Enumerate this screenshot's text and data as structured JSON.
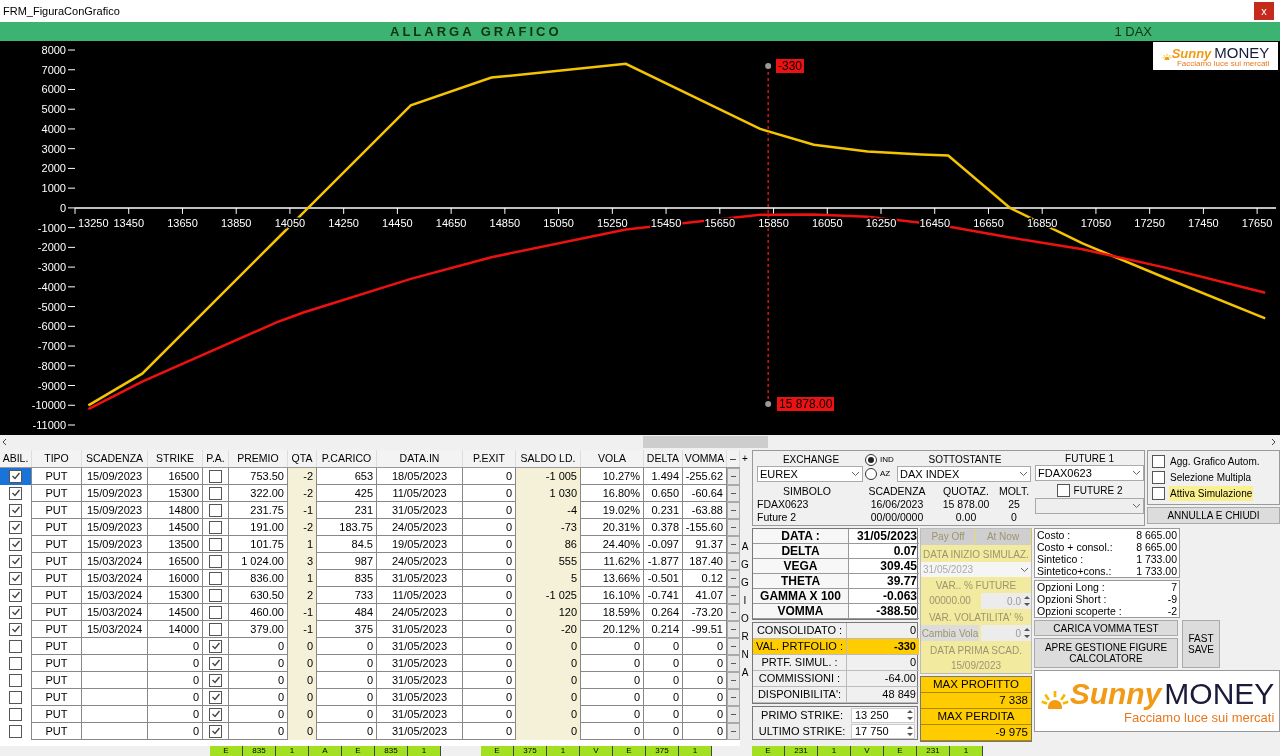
{
  "window": {
    "title": "FRM_FiguraConGrafico",
    "close": "x"
  },
  "header_bar": {
    "title": "ALLARGA GRAFICO",
    "underlying": "1 DAX"
  },
  "chart": {
    "logo": {
      "script": "Sunny",
      "word": "MONEY",
      "tagline": "Facciamo luce sui mercati"
    },
    "cursor": {
      "value_label": "-330",
      "price_label": "15 878.00"
    },
    "chart_data": {
      "type": "line",
      "x": [
        13300,
        13500,
        14000,
        14100,
        14500,
        14800,
        15300,
        15800,
        16000,
        16200,
        16400,
        16500,
        16730,
        17000,
        17300,
        17680
      ],
      "series": [
        {
          "color": "#f5c400",
          "values": [
            -10000,
            -8400,
            -1600,
            -240,
            5200,
            6600,
            7300,
            4000,
            3200,
            2850,
            2700,
            2650,
            0,
            -1800,
            -3500,
            -5600
          ]
        },
        {
          "color": "#ee1111",
          "values": [
            -10200,
            -8800,
            -5800,
            -5300,
            -3600,
            -2500,
            -1100,
            -350,
            -330,
            -450,
            -750,
            -950,
            -1500,
            -2100,
            -3000,
            -4300
          ]
        }
      ],
      "ref_lines": [
        {
          "axis": "x",
          "value": 15830
        }
      ],
      "xlim": [
        13250,
        17750
      ],
      "ylim": [
        -11000,
        8000
      ],
      "xticks": [
        13250,
        13450,
        13650,
        13850,
        14050,
        14250,
        14450,
        14650,
        14850,
        15050,
        15250,
        15450,
        15650,
        15850,
        16050,
        16250,
        16450,
        16650,
        16850,
        17050,
        17250,
        17450,
        17650
      ],
      "yticks": [
        8000,
        7000,
        6000,
        5000,
        4000,
        3000,
        2000,
        1000,
        0,
        -1000,
        -2000,
        -3000,
        -4000,
        -5000,
        -6000,
        -7000,
        -8000,
        -9000,
        -10000,
        -11000
      ]
    }
  },
  "table": {
    "columns": [
      "ABIL.",
      "TIPO",
      "SCADENZA",
      "STRIKE",
      "P.A.",
      "PREMIO",
      "QTA",
      "P.CARICO",
      "DATA.IN",
      "P.EXIT",
      "SALDO LD.",
      "VOLA",
      "DELTA",
      "VOMMA",
      "–"
    ],
    "add_button": "+",
    "rows": [
      {
        "selected": true,
        "abil": true,
        "tipo": "PUT",
        "scadenza": "15/09/2023",
        "strike": "16500",
        "pa": false,
        "premio": "753.50",
        "qta": "-2",
        "pcarico": "653",
        "data_in": "18/05/2023",
        "pexit": "0",
        "saldo": "-1 005",
        "vola": "10.27%",
        "delta": "1.494",
        "vomma": "-255.62",
        "action": "–"
      },
      {
        "selected": false,
        "abil": true,
        "tipo": "PUT",
        "scadenza": "15/09/2023",
        "strike": "15300",
        "pa": false,
        "premio": "322.00",
        "qta": "-2",
        "pcarico": "425",
        "data_in": "11/05/2023",
        "pexit": "0",
        "saldo": "1 030",
        "vola": "16.80%",
        "delta": "0.650",
        "vomma": "-60.64",
        "action": "–"
      },
      {
        "selected": false,
        "abil": true,
        "tipo": "PUT",
        "scadenza": "15/09/2023",
        "strike": "14800",
        "pa": false,
        "premio": "231.75",
        "qta": "-1",
        "pcarico": "231",
        "data_in": "31/05/2023",
        "pexit": "0",
        "saldo": "-4",
        "vola": "19.02%",
        "delta": "0.231",
        "vomma": "-63.88",
        "action": "–"
      },
      {
        "selected": false,
        "abil": true,
        "tipo": "PUT",
        "scadenza": "15/09/2023",
        "strike": "14500",
        "pa": false,
        "premio": "191.00",
        "qta": "-2",
        "pcarico": "183.75",
        "data_in": "24/05/2023",
        "pexit": "0",
        "saldo": "-73",
        "vola": "20.31%",
        "delta": "0.378",
        "vomma": "-155.60",
        "action": "–"
      },
      {
        "selected": false,
        "abil": true,
        "tipo": "PUT",
        "scadenza": "15/09/2023",
        "strike": "13500",
        "pa": false,
        "premio": "101.75",
        "qta": "1",
        "pcarico": "84.5",
        "data_in": "19/05/2023",
        "pexit": "0",
        "saldo": "86",
        "vola": "24.40%",
        "delta": "-0.097",
        "vomma": "91.37",
        "action": "–"
      },
      {
        "selected": false,
        "abil": true,
        "tipo": "PUT",
        "scadenza": "15/03/2024",
        "strike": "16500",
        "pa": false,
        "premio": "1 024.00",
        "qta": "3",
        "pcarico": "987",
        "data_in": "24/05/2023",
        "pexit": "0",
        "saldo": "555",
        "vola": "11.62%",
        "delta": "-1.877",
        "vomma": "187.40",
        "action": "–"
      },
      {
        "selected": false,
        "abil": true,
        "tipo": "PUT",
        "scadenza": "15/03/2024",
        "strike": "16000",
        "pa": false,
        "premio": "836.00",
        "qta": "1",
        "pcarico": "835",
        "data_in": "31/05/2023",
        "pexit": "0",
        "saldo": "5",
        "vola": "13.66%",
        "delta": "-0.501",
        "vomma": "0.12",
        "action": "–"
      },
      {
        "selected": false,
        "abil": true,
        "tipo": "PUT",
        "scadenza": "15/03/2024",
        "strike": "15300",
        "pa": false,
        "premio": "630.50",
        "qta": "2",
        "pcarico": "733",
        "data_in": "11/05/2023",
        "pexit": "0",
        "saldo": "-1 025",
        "vola": "16.10%",
        "delta": "-0.741",
        "vomma": "41.07",
        "action": "–"
      },
      {
        "selected": false,
        "abil": true,
        "tipo": "PUT",
        "scadenza": "15/03/2024",
        "strike": "14500",
        "pa": false,
        "premio": "460.00",
        "qta": "-1",
        "pcarico": "484",
        "data_in": "24/05/2023",
        "pexit": "0",
        "saldo": "120",
        "vola": "18.59%",
        "delta": "0.264",
        "vomma": "-73.20",
        "action": "–"
      },
      {
        "selected": false,
        "abil": true,
        "tipo": "PUT",
        "scadenza": "15/03/2024",
        "strike": "14000",
        "pa": false,
        "premio": "379.00",
        "qta": "-1",
        "pcarico": "375",
        "data_in": "31/05/2023",
        "pexit": "0",
        "saldo": "-20",
        "vola": "20.12%",
        "delta": "0.214",
        "vomma": "-99.51",
        "action": "–"
      },
      {
        "selected": false,
        "abil": false,
        "tipo": "PUT",
        "strike": "0",
        "pa": true,
        "premio": "0",
        "qta": "0",
        "pcarico": "0",
        "data_in": "31/05/2023",
        "pexit": "0",
        "saldo": "0",
        "vola": "0",
        "delta": "0",
        "vomma": "0",
        "action": "–"
      },
      {
        "selected": false,
        "abil": false,
        "tipo": "PUT",
        "strike": "0",
        "pa": true,
        "premio": "0",
        "qta": "0",
        "pcarico": "0",
        "data_in": "31/05/2023",
        "pexit": "0",
        "saldo": "0",
        "vola": "0",
        "delta": "0",
        "vomma": "0",
        "action": "–"
      },
      {
        "selected": false,
        "abil": false,
        "tipo": "PUT",
        "strike": "0",
        "pa": true,
        "premio": "0",
        "qta": "0",
        "pcarico": "0",
        "data_in": "31/05/2023",
        "pexit": "0",
        "saldo": "0",
        "vola": "0",
        "delta": "0",
        "vomma": "0",
        "action": "–"
      },
      {
        "selected": false,
        "abil": false,
        "tipo": "PUT",
        "strike": "0",
        "pa": true,
        "premio": "0",
        "qta": "0",
        "pcarico": "0",
        "data_in": "31/05/2023",
        "pexit": "0",
        "saldo": "0",
        "vola": "0",
        "delta": "0",
        "vomma": "0",
        "action": "–"
      },
      {
        "selected": false,
        "abil": false,
        "tipo": "PUT",
        "strike": "0",
        "pa": true,
        "premio": "0",
        "qta": "0",
        "pcarico": "0",
        "data_in": "31/05/2023",
        "pexit": "0",
        "saldo": "0",
        "vola": "0",
        "delta": "0",
        "vomma": "0",
        "action": "–"
      },
      {
        "selected": false,
        "abil": false,
        "tipo": "PUT",
        "strike": "0",
        "pa": true,
        "premio": "0",
        "qta": "0",
        "pcarico": "0",
        "data_in": "31/05/2023",
        "pexit": "0",
        "saldo": "0",
        "vola": "0",
        "delta": "0",
        "vomma": "0",
        "action": "–"
      }
    ]
  },
  "refresh_label": "AGGIORNA",
  "market": {
    "exchange": {
      "label": "EXCHANGE",
      "value": "EUREX"
    },
    "radios": [
      {
        "label": "IND",
        "selected": true
      },
      {
        "label": "AZ",
        "selected": false
      }
    ],
    "underlying": {
      "label": "SOTTOSTANTE",
      "value": "DAX INDEX"
    },
    "future1": {
      "label": "FUTURE 1",
      "value": "FDAX0623"
    },
    "future2": {
      "label": "FUTURE 2",
      "checked": false
    },
    "instrument_columns": [
      "SIMBOLO",
      "SCADENZA",
      "QUOTAZ.",
      "MOLT."
    ],
    "instruments": [
      [
        "FDAX0623",
        "16/06/2023",
        "15 878.00",
        "25"
      ],
      [
        "Future 2",
        "00/00/0000",
        "0.00",
        "0"
      ]
    ]
  },
  "options": [
    {
      "label": "Agg. Grafico Autom.",
      "checked": false,
      "highlighted": false
    },
    {
      "label": "Selezione Multipla",
      "checked": false,
      "highlighted": false
    },
    {
      "label": "Attiva Simulazione",
      "checked": false,
      "highlighted": true
    }
  ],
  "close_button": "ANNULLA E CHIUDI",
  "greeks": [
    {
      "label": "DATA :",
      "value": "31/05/2023"
    },
    {
      "label": "DELTA",
      "value": "0.07"
    },
    {
      "label": "VEGA",
      "value": "309.45"
    },
    {
      "label": "THETA",
      "value": "39.77"
    },
    {
      "label": "GAMMA X 100",
      "value": "-0.063"
    },
    {
      "label": "VOMMA",
      "value": "-388.50"
    }
  ],
  "portfolio": [
    {
      "label": "CONSOLIDATO :",
      "value": "0",
      "highlighted": false
    },
    {
      "label": "VAL. PRTFOLIO :",
      "value": "-330",
      "highlighted": true
    },
    {
      "label": "PRTF. SIMUL. :",
      "value": "0",
      "highlighted": false
    },
    {
      "label": "COMMISSIONI :",
      "value": "-64.00",
      "highlighted": false
    },
    {
      "label": "DISPONIBILITA':",
      "value": "48 849",
      "highlighted": false
    }
  ],
  "strikes": [
    {
      "label": "PRIMO STRIKE:",
      "value": "13 250"
    },
    {
      "label": "ULTIMO STRIKE:",
      "value": "17 750"
    }
  ],
  "simulation": {
    "disabled": true,
    "tabs": [
      {
        "label": "Pay Off",
        "selected": false
      },
      {
        "label": "At Now",
        "selected": false
      }
    ],
    "start_label": "DATA INIZIO SIMULAZ.",
    "start_date": "31/05/2023",
    "future_label": "VAR.. % FUTURE",
    "future_value": "00000.00",
    "future_pct": "0.0",
    "vola_label": "VAR. VOLATILITA' %",
    "vola_button": "Cambia Vola",
    "vola_value": "0",
    "first_expiry_label": "DATA PRIMA SCAD.",
    "first_expiry": "15/09/2023"
  },
  "extremes": [
    {
      "label": "MAX PROFITTO",
      "value": "7 338"
    },
    {
      "label": "MAX PERDITA",
      "value": "-9 975"
    }
  ],
  "costs": [
    {
      "label": "Costo :",
      "value": "8 665.00"
    },
    {
      "label": "Costo + consol.:",
      "value": "8 665.00"
    },
    {
      "label": "Sintetico :",
      "value": "1 733.00"
    },
    {
      "label": "Sintetico+cons.:",
      "value": "1 733.00"
    }
  ],
  "option_counts": [
    {
      "label": "Opzioni Long :",
      "value": "7"
    },
    {
      "label": "Opzioni Short :",
      "value": "-9"
    },
    {
      "label": "Opzioni scoperte :",
      "value": "-2"
    }
  ],
  "buttons": {
    "vomma_test": "CARICA VOMMA TEST",
    "open_manager": "APRE GESTIONE FIGURE CALCOLATORE",
    "fast_save": "FAST SAVE"
  },
  "logo": {
    "script": "Sunny",
    "word": "MONEY",
    "tagline": "Facciamo luce sui mercati"
  },
  "bottom_strip": [
    [
      "E",
      "835",
      "1",
      "A",
      "E",
      "835",
      "1"
    ],
    [
      "E",
      "375",
      "1",
      "V",
      "E",
      "375",
      "1"
    ],
    [
      "E",
      "231",
      "1",
      "V",
      "E",
      "231",
      "1"
    ]
  ]
}
